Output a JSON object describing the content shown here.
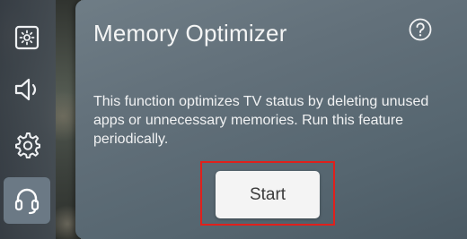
{
  "panel": {
    "title": "Memory Optimizer",
    "description": "This function optimizes TV status by deleting unused apps or unnecessary memories. Run this feature periodically.",
    "start_label": "Start"
  },
  "side_menu": {
    "items": [
      {
        "icon": "picture-icon",
        "active": false
      },
      {
        "icon": "speaker-icon",
        "active": false
      },
      {
        "icon": "gear-icon",
        "active": false
      },
      {
        "icon": "headset-icon",
        "active": true
      }
    ]
  },
  "colors": {
    "highlight": "#e0201c",
    "button_bg": "#f4f4f4",
    "panel_bg": "#62707a"
  }
}
